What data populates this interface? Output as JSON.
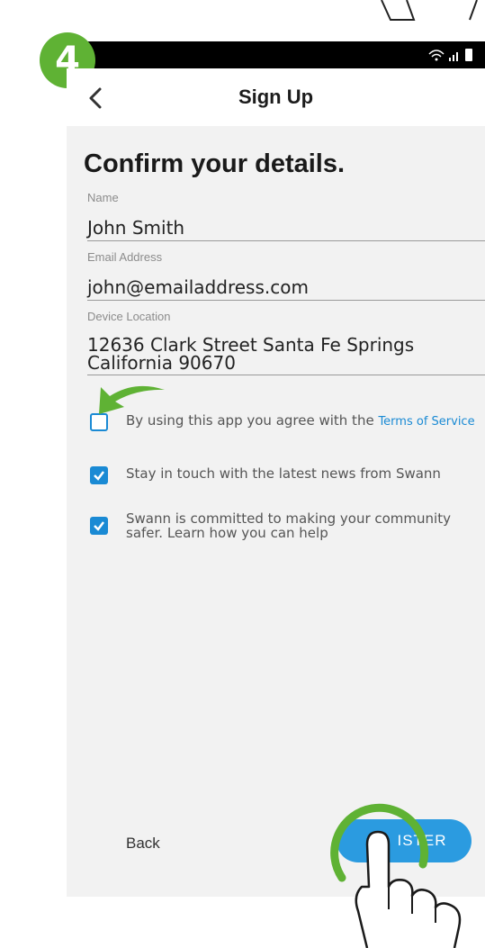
{
  "step_number": "4",
  "header": {
    "title": "Sign Up"
  },
  "form": {
    "heading": "Confirm your details.",
    "name_label": "Name",
    "name_value": "John Smith",
    "email_label": "Email Address",
    "email_value": "john@emailaddress.com",
    "location_label": "Device Location",
    "location_value_line1": "12636 Clark Street Santa Fe Springs",
    "location_value_line2": "California  90670"
  },
  "consents": [
    {
      "text": "By using this app you agree with the ",
      "link": "Terms of Service",
      "checked": false
    },
    {
      "text": "Stay in touch with the latest news from Swann",
      "checked": true
    },
    {
      "text_line1": "Swann is committed to making your community",
      "text_line2": "safer. Learn how you can help",
      "checked": true
    }
  ],
  "footer": {
    "back_label": "Back",
    "register_label": "REGISTER",
    "register_visible": "ISTER"
  },
  "colors": {
    "accent": "#1a8ad4",
    "badge": "#5fb234",
    "button": "#2b9be0"
  }
}
